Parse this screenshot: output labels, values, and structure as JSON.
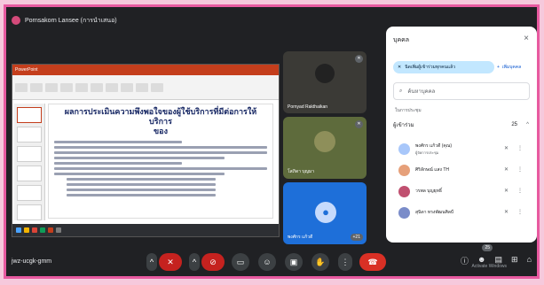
{
  "presenter": {
    "label": "Pornsakorn Lansee (การนำเสนอ)"
  },
  "slide": {
    "app_title": "PowerPoint",
    "title_line1": "ผลการประเมินความพึงพอใจของผู้ใช้บริการที่มีต่อการให้บริการ",
    "title_line2": "ของ"
  },
  "tiles": [
    {
      "name": "Pornyad Rakthaikan",
      "initial": ""
    },
    {
      "name": "โสภิดา บุญมา",
      "initial": ""
    },
    {
      "name": "พงศักร แก้วดี",
      "initial": "",
      "badge": "+21"
    }
  ],
  "panel": {
    "title": "บุคคล",
    "close": "×",
    "add_all_label": "นิดเพิ่มผู้เข้าร่วมทุกคนแล้ว",
    "add_people_label": "เพิ่มบุคคล",
    "search_placeholder": "ค้นหาบุคคล",
    "section_label": "ในการประชุม",
    "section_title": "ผู้เข้าร่วม",
    "section_count": "25",
    "participants": [
      {
        "name": "พงศักร แก้วดี (คุณ)",
        "role": "ผู้จัดการประชุม"
      },
      {
        "name": "ศิริลักษณ์ แสง TH",
        "role": ""
      },
      {
        "name": "วรพล บุญยุทธิ์",
        "role": ""
      },
      {
        "name": "สุนิดา ทรงพัฒนศิลป์",
        "role": ""
      }
    ]
  },
  "bottom": {
    "meeting_code": "jwz-ucgk-gmm",
    "activate_text": "Activate Windows",
    "people_badge": "25"
  }
}
